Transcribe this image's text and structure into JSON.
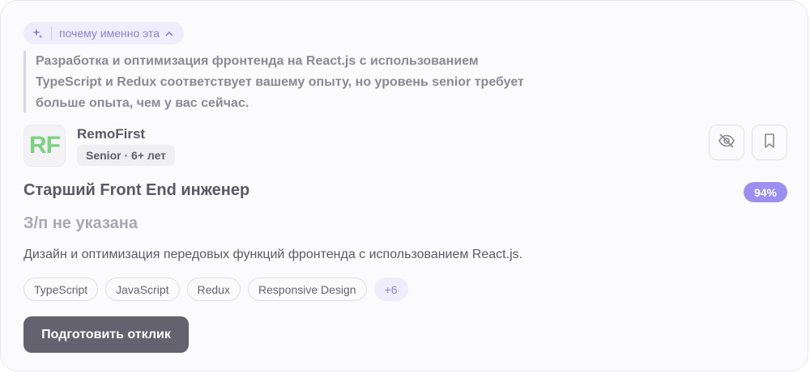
{
  "why_toggle": {
    "label": "почему именно эта",
    "icon": "sparkle-icon",
    "chevron": "chevron-up-icon"
  },
  "reason_text": "Разработка и оптимизация фронтенда на React.js с использованием TypeScript и Redux соответствует вашему опыту, но уровень senior требует больше опыта, чем у вас сейчас.",
  "company": {
    "logo_text": "RF",
    "name": "RemoFirst",
    "level": "Senior · 6+ лет"
  },
  "actions": {
    "hide_icon": "eye-off-icon",
    "save_icon": "bookmark-icon"
  },
  "job": {
    "title": "Старший Front End инженер",
    "match": "94%",
    "salary": "З/п не указана",
    "description": "Дизайн и оптимизация передовых функций фронтенда с использованием React.js."
  },
  "tags": [
    "TypeScript",
    "JavaScript",
    "Redux",
    "Responsive Design"
  ],
  "more_tags": "+6",
  "apply_label": "Подготовить отклик",
  "colors": {
    "accent": "#9c8ff0",
    "logo": "#7fd184",
    "button": "#64626e"
  }
}
